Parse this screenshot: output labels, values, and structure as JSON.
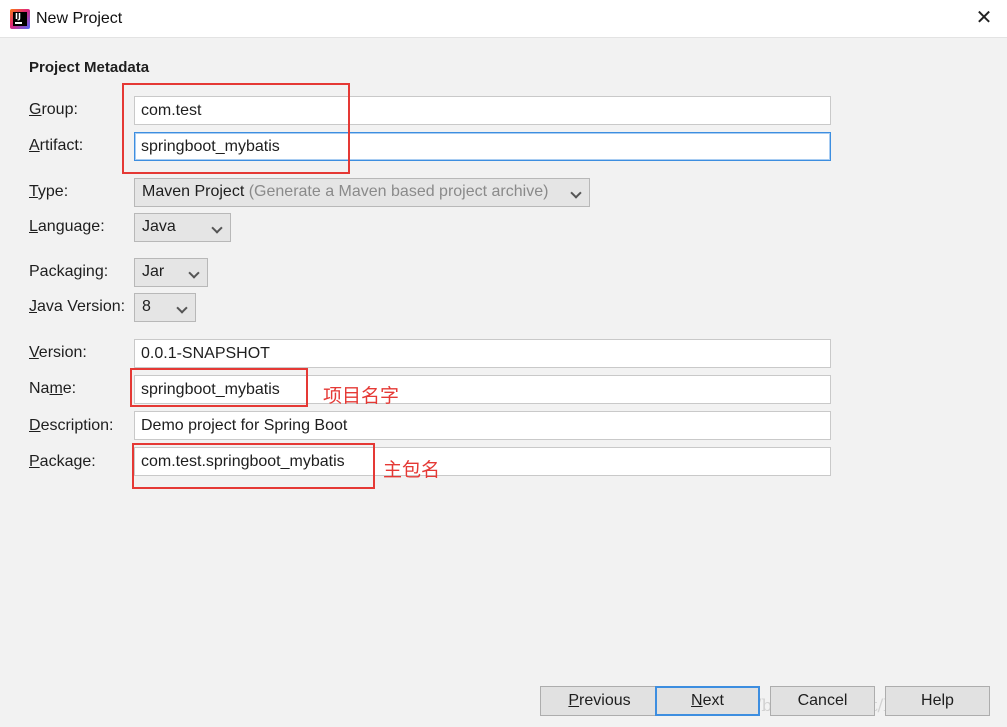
{
  "window": {
    "title": "New Project"
  },
  "section": {
    "title": "Project Metadata"
  },
  "form": {
    "group": {
      "label_key": "G",
      "label_rest": "roup:",
      "value": "com.test"
    },
    "artifact": {
      "label_key": "A",
      "label_rest": "rtifact:",
      "value": "springboot_mybatis"
    },
    "type": {
      "label_key": "T",
      "label_rest": "ype:",
      "value": "Maven Project",
      "hint": "(Generate a Maven based project archive)"
    },
    "language": {
      "label_key": "L",
      "label_rest": "anguage:",
      "value": "Java"
    },
    "packaging": {
      "label_pre": "Packa",
      "label_key": "g",
      "label_rest": "ing:",
      "value": "Jar"
    },
    "java_version": {
      "label_key": "J",
      "label_rest": "ava Version:",
      "value": "8"
    },
    "version": {
      "label_key": "V",
      "label_rest": "ersion:",
      "value": "0.0.1-SNAPSHOT"
    },
    "name": {
      "label_pre": "Na",
      "label_key": "m",
      "label_rest": "e:",
      "value": "springboot_mybatis"
    },
    "description": {
      "label_key": "D",
      "label_rest": "escription:",
      "value": "Demo project for Spring Boot"
    },
    "package": {
      "label_key": "P",
      "label_rest": "ackage:",
      "value": "com.test.springboot_mybatis"
    }
  },
  "annotations": {
    "name_note": "项目名字",
    "package_note": "主包名",
    "color": "#e53935"
  },
  "buttons": {
    "previous_key": "P",
    "previous_rest": "revious",
    "next_key": "N",
    "next_rest": "ext",
    "cancel": "Cancel",
    "help": "Help"
  },
  "watermark": "https://blog.csdn.net/bdqnjgcio",
  "colors": {
    "accent": "#3d8ee0",
    "background": "#f2f2f2"
  },
  "icons": {
    "app": "intellij-idea-icon",
    "close": "close-icon"
  }
}
